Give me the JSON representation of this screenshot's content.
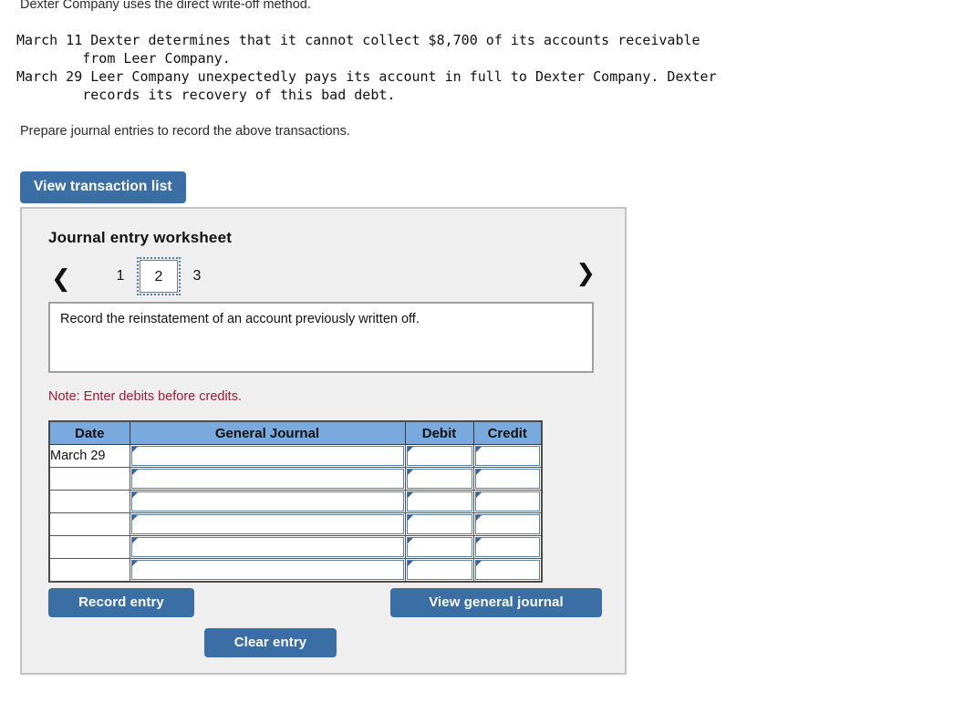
{
  "problem": {
    "intro": "Dexter Company uses the direct write-off method.",
    "transactions_text": "March 11 Dexter determines that it cannot collect $8,700 of its accounts receivable\n        from Leer Company.\nMarch 29 Leer Company unexpectedly pays its account in full to Dexter Company. Dexter\n        records its recovery of this bad debt.",
    "prepare": "Prepare journal entries to record the above transactions."
  },
  "toolbar": {
    "view_transaction_list_label": "View transaction list"
  },
  "worksheet": {
    "title": "Journal entry worksheet",
    "pager": {
      "prev_icon": "‹",
      "next_icon": "›",
      "tabs": [
        "1",
        "2",
        "3"
      ],
      "active_tab": "2"
    },
    "instruction": "Record the reinstatement of an account previously written off.",
    "note": "Note: Enter debits before credits.",
    "table": {
      "columns": [
        "Date",
        "General Journal",
        "Debit",
        "Credit"
      ],
      "rows": [
        {
          "date": "March 29",
          "journal": "",
          "debit": "",
          "credit": ""
        },
        {
          "date": "",
          "journal": "",
          "debit": "",
          "credit": ""
        },
        {
          "date": "",
          "journal": "",
          "debit": "",
          "credit": ""
        },
        {
          "date": "",
          "journal": "",
          "debit": "",
          "credit": ""
        },
        {
          "date": "",
          "journal": "",
          "debit": "",
          "credit": ""
        },
        {
          "date": "",
          "journal": "",
          "debit": "",
          "credit": ""
        }
      ]
    },
    "buttons": {
      "record_entry_label": "Record entry",
      "clear_entry_label": "Clear entry",
      "view_general_journal_label": "View general journal"
    }
  },
  "colors": {
    "button_blue": "#3b6ea5",
    "table_header_blue": "#7aa9dd",
    "note_red": "#9e1b32",
    "panel_bg": "#efefef",
    "panel_border": "#c3c3c3",
    "field_border": "#5c7fa8"
  }
}
